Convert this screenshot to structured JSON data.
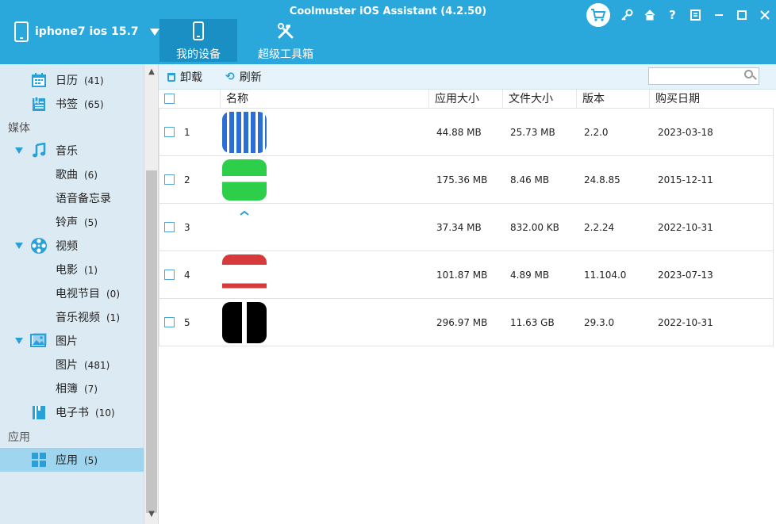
{
  "window": {
    "title": "Coolmuster iOS Assistant (4.2.50)",
    "device_name": "iphone7 ios 15.7"
  },
  "nav_tabs": [
    {
      "label": "我的设备",
      "active": true,
      "icon": "phone-icon"
    },
    {
      "label": "超级工具箱",
      "active": false,
      "icon": "tools-icon"
    }
  ],
  "titlebar_icons": [
    "cart-icon",
    "key-icon",
    "home-icon",
    "help-icon",
    "feedback-icon",
    "minimize-icon",
    "maximize-icon",
    "close-icon"
  ],
  "titlebar_glyphs": {
    "help": "?"
  },
  "sidebar": {
    "items": [
      {
        "label": "日历",
        "count": "(41)"
      },
      {
        "label": "书签",
        "count": "(65)"
      },
      {
        "label": "媒体",
        "type": "section"
      },
      {
        "label": "音乐"
      },
      {
        "label": "歌曲",
        "count": "(6)"
      },
      {
        "label": "语音备忘录"
      },
      {
        "label": "铃声",
        "count": "(5)"
      },
      {
        "label": "视频"
      },
      {
        "label": "电影",
        "count": "(1)"
      },
      {
        "label": "电视节目",
        "count": "(0)"
      },
      {
        "label": "音乐视频",
        "count": "(1)"
      },
      {
        "label": "图片"
      },
      {
        "label": "图片",
        "count": "(481)"
      },
      {
        "label": "相簿",
        "count": "(7)"
      },
      {
        "label": "电子书",
        "count": "(10)"
      },
      {
        "label": "应用",
        "type": "section"
      },
      {
        "label": "应用",
        "count": "(5)",
        "active": true
      }
    ]
  },
  "toolbar": {
    "uninstall_label": "卸载",
    "refresh_label": "刷新",
    "search_placeholder": ""
  },
  "table": {
    "columns": [
      "名称",
      "应用大小",
      "文件大小",
      "版本",
      "购买日期"
    ],
    "rows": [
      {
        "index": "1",
        "name": "",
        "app_size": "44.88 MB",
        "file_size": "25.73 MB",
        "version": "2.2.0",
        "date": "2023-03-18",
        "icon_color": "#2b6fd6"
      },
      {
        "index": "2",
        "name": "",
        "app_size": "175.36 MB",
        "file_size": "8.46 MB",
        "version": "24.8.85",
        "date": "2015-12-11",
        "icon_color": "#2dcf4a"
      },
      {
        "index": "3",
        "name": "",
        "app_size": "37.34 MB",
        "file_size": "832.00 KB",
        "version": "2.2.24",
        "date": "2022-10-31",
        "icon_color": "#ffffff"
      },
      {
        "index": "4",
        "name": "",
        "app_size": "101.87 MB",
        "file_size": "4.89 MB",
        "version": "11.104.0",
        "date": "2023-07-13",
        "icon_color": "#d63a3a"
      },
      {
        "index": "5",
        "name": "",
        "app_size": "296.97 MB",
        "file_size": "11.63 GB",
        "version": "29.3.0",
        "date": "2022-10-31",
        "icon_color": "#000000"
      }
    ]
  },
  "colors": {
    "titlebar": "#2aa8dc",
    "active_tab": "#1a8fc4",
    "sidebar": "#dceaf3",
    "sidebar_active": "#9fd5ef",
    "accent": "#2aa0d8"
  }
}
